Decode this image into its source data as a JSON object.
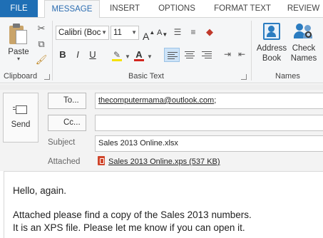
{
  "tabs": {
    "file": "FILE",
    "items": [
      "MESSAGE",
      "INSERT",
      "OPTIONS",
      "FORMAT TEXT",
      "REVIEW"
    ],
    "active": "MESSAGE"
  },
  "ribbon": {
    "clipboard": {
      "paste_label": "Paste",
      "group_label": "Clipboard"
    },
    "basic_text": {
      "font_name": "Calibri (Boc",
      "font_size": "11",
      "bold": "B",
      "italic": "I",
      "underline": "U",
      "font_color_glyph": "A",
      "grow_glyph": "A",
      "shrink_glyph": "A",
      "group_label": "Basic Text"
    },
    "names": {
      "address_book_line1": "Address",
      "address_book_line2": "Book",
      "check_names_line1": "Check",
      "check_names_line2": "Names",
      "group_label": "Names"
    }
  },
  "compose": {
    "send_label": "Send",
    "to_label": "To...",
    "to_value": "thecomputermama@outlook.com",
    "to_suffix": ";",
    "cc_label": "Cc...",
    "cc_value": "",
    "subject_label": "Subject",
    "subject_value": "Sales 2013 Online.xlsx",
    "attached_label": "Attached",
    "attachment": "Sales 2013 Online.xps (537 KB)"
  },
  "body": {
    "line1": "Hello, again.",
    "line2": "Attached please find a copy of the Sales 2013 numbers.",
    "line3": "It is an XPS file. Please let me know if you can open it."
  },
  "colors": {
    "file_tab": "#1f6fb5",
    "accent": "#2b7cc0",
    "highlight_yellow": "#f5e100",
    "font_color_red": "#d2261f",
    "attachment_icon": "#d0452b"
  }
}
